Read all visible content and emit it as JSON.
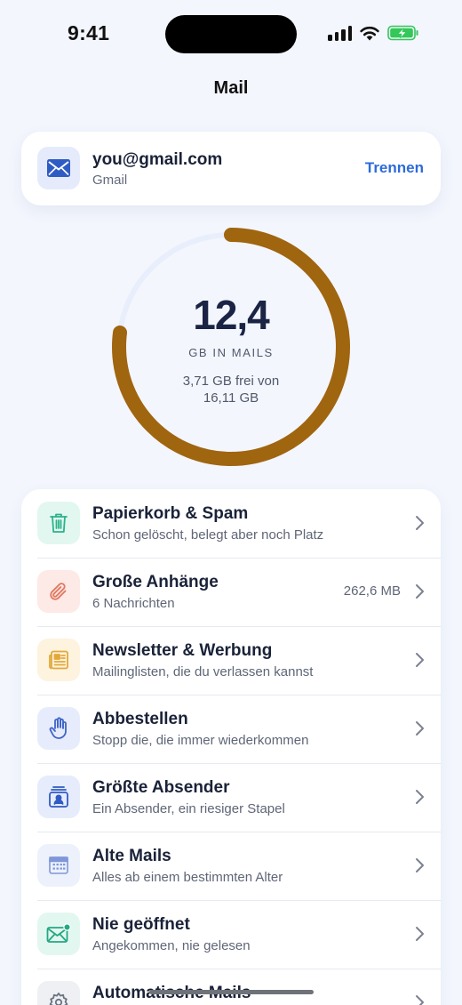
{
  "status": {
    "time": "9:41"
  },
  "nav": {
    "title": "Mail"
  },
  "account": {
    "email": "you@gmail.com",
    "provider": "Gmail",
    "action_label": "Trennen"
  },
  "storage": {
    "value": "12,4",
    "unit": "GB IN MAILS",
    "free_line1": "3,71 GB frei von",
    "free_line2": "16,11 GB",
    "fill_fraction": 0.77,
    "color": "#a0650f"
  },
  "rows": [
    {
      "title": "Papierkorb & Spam",
      "subtitle": "Schon gelöscht, belegt aber noch Platz",
      "value": "",
      "icon": "trash-icon",
      "tint": "#e3f7f1",
      "color": "#2bb38a"
    },
    {
      "title": "Große Anhänge",
      "subtitle": "6 Nachrichten",
      "value": "262,6 MB",
      "icon": "paperclip-icon",
      "tint": "#fde9e5",
      "color": "#e07a63"
    },
    {
      "title": "Newsletter & Werbung",
      "subtitle": "Mailinglisten, die du verlassen kannst",
      "value": "",
      "icon": "newspaper-icon",
      "tint": "#fdf3de",
      "color": "#e2a93a"
    },
    {
      "title": "Abbestellen",
      "subtitle": "Stopp die, die immer wiederkommen",
      "value": "",
      "icon": "hand-icon",
      "tint": "#e6ecfb",
      "color": "#4065c8"
    },
    {
      "title": "Größte Absender",
      "subtitle": "Ein Absender, ein riesiger Stapel",
      "value": "",
      "icon": "contact-card-icon",
      "tint": "#e6ecfb",
      "color": "#2f5bc4"
    },
    {
      "title": "Alte Mails",
      "subtitle": "Alles ab einem bestimmten Alter",
      "value": "",
      "icon": "calendar-icon",
      "tint": "#edf1fc",
      "color": "#7e97d8"
    },
    {
      "title": "Nie geöffnet",
      "subtitle": "Angekommen, nie gelesen",
      "value": "",
      "icon": "unread-mail-icon",
      "tint": "#e3f7f1",
      "color": "#24a882"
    },
    {
      "title": "Automatische Mails",
      "subtitle": "",
      "value": "",
      "icon": "gear-icon",
      "tint": "#eef0f4",
      "color": "#6b7280"
    }
  ]
}
